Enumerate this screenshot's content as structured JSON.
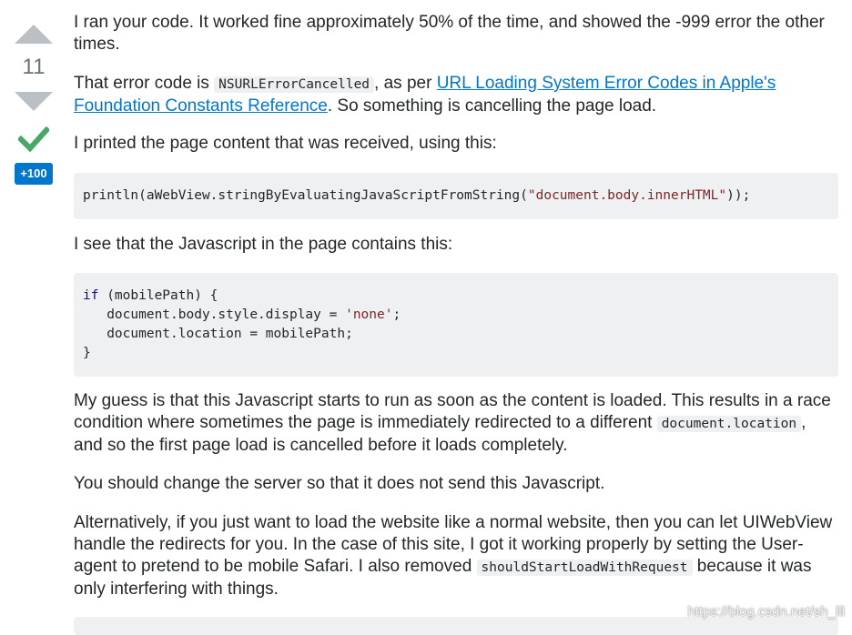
{
  "vote": {
    "count": "11",
    "bounty": "+100"
  },
  "answer": {
    "p1": "I ran your code. It worked fine approximately 50% of the time, and showed the -999 error the other times.",
    "p2_a": "That error code is ",
    "p2_code": "NSURLErrorCancelled",
    "p2_b": ", as per ",
    "p2_link": "URL Loading System Error Codes in Apple's Foundation Constants Reference",
    "p2_c": ". So something is cancelling the page load.",
    "p3": "I printed the page content that was received, using this:",
    "code1": {
      "pre": "println(aWebView.stringByEvaluatingJavaScriptFromString(",
      "str": "\"document.body.innerHTML\"",
      "post": "));"
    },
    "p4": "I see that the Javascript in the page contains this:",
    "code2": {
      "kw_if": "if",
      "line1_rest": " (mobilePath) {",
      "line2_pre": "   document.body.style.display = ",
      "line2_str": "'none'",
      "line2_post": ";",
      "line3": "   document.location = mobilePath;",
      "line4": "}"
    },
    "p5_a": "My guess is that this Javascript starts to run as soon as the content is loaded. This results in a race condition where sometimes the page is immediately redirected to a different ",
    "p5_code": "document.location",
    "p5_b": ", and so the first page load is cancelled before it loads completely.",
    "p6": "You should change the server so that it does not send this Javascript.",
    "p7_a": "Alternatively, if you just want to load the website like a normal website, then you can let UIWebView handle the redirects for you. In the case of this site, I got it working properly by setting the User-agent to pretend to be mobile Safari. I also removed ",
    "p7_code": "shouldStartLoadWithRequest",
    "p7_b": " because it was only interfering with things."
  },
  "watermark": "https://blog.csdn.net/sh_lll",
  "colors": {
    "accent": "#0077cc",
    "accepted": "#48a868",
    "vote_arrow": "#bbc0c4",
    "code_bg": "#eff0f1"
  },
  "icons": {
    "upvote": "arrow-up-icon",
    "downvote": "arrow-down-icon",
    "accepted": "checkmark-icon"
  }
}
